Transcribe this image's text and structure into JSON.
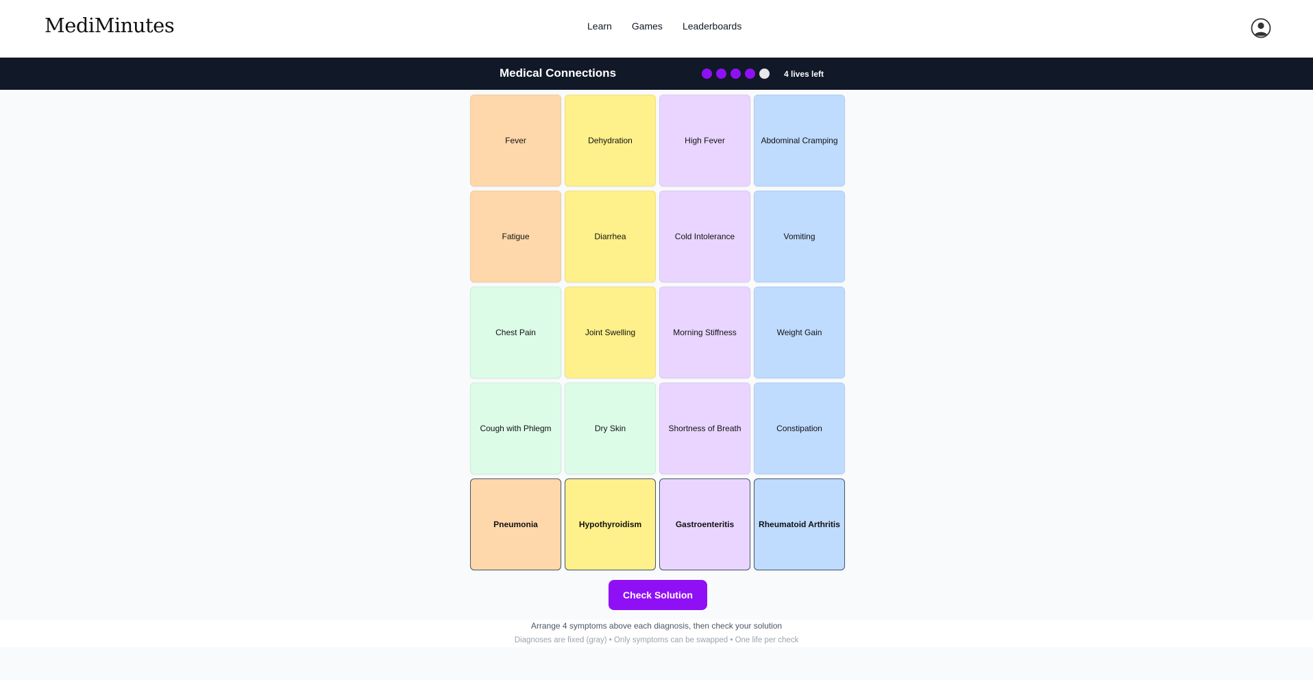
{
  "brand": {
    "name": "MediMinutes"
  },
  "nav": {
    "items": [
      "Learn",
      "Games",
      "Leaderboards"
    ]
  },
  "game": {
    "title": "Medical Connections",
    "lives_total": 5,
    "lives_remaining": 4,
    "lives_text": "4 lives left"
  },
  "colors": {
    "accent": "#9010f5",
    "header_bg": "#111827",
    "orange": "#fed7aa",
    "yellow": "#fef08a",
    "purple": "#e9d5ff",
    "blue": "#bfdbfe",
    "green": "#dcfce7"
  },
  "symptom_rows": [
    [
      {
        "label": "Fever",
        "color": "orange"
      },
      {
        "label": "Dehydration",
        "color": "yellow"
      },
      {
        "label": "High Fever",
        "color": "purple"
      },
      {
        "label": "Abdominal Cramping",
        "color": "blue"
      }
    ],
    [
      {
        "label": "Fatigue",
        "color": "orange"
      },
      {
        "label": "Diarrhea",
        "color": "yellow"
      },
      {
        "label": "Cold Intolerance",
        "color": "purple"
      },
      {
        "label": "Vomiting",
        "color": "blue"
      }
    ],
    [
      {
        "label": "Chest Pain",
        "color": "green"
      },
      {
        "label": "Joint Swelling",
        "color": "yellow"
      },
      {
        "label": "Morning Stiffness",
        "color": "purple"
      },
      {
        "label": "Weight Gain",
        "color": "blue"
      }
    ],
    [
      {
        "label": "Cough with Phlegm",
        "color": "green"
      },
      {
        "label": "Dry Skin",
        "color": "green"
      },
      {
        "label": "Shortness of Breath",
        "color": "purple"
      },
      {
        "label": "Constipation",
        "color": "blue"
      }
    ]
  ],
  "diagnoses": [
    {
      "label": "Pneumonia",
      "color": "orange"
    },
    {
      "label": "Hypothyroidism",
      "color": "yellow"
    },
    {
      "label": "Gastroenteritis",
      "color": "purple"
    },
    {
      "label": "Rheumatoid Arthritis",
      "color": "blue"
    }
  ],
  "actions": {
    "check_label": "Check Solution"
  },
  "instructions": {
    "main": "Arrange 4 symptoms above each diagnosis, then check your solution",
    "sub": "Diagnoses are fixed (gray) • Only symptoms can be swapped • One life per check"
  },
  "icons": {
    "profile": "user-circle-icon"
  }
}
